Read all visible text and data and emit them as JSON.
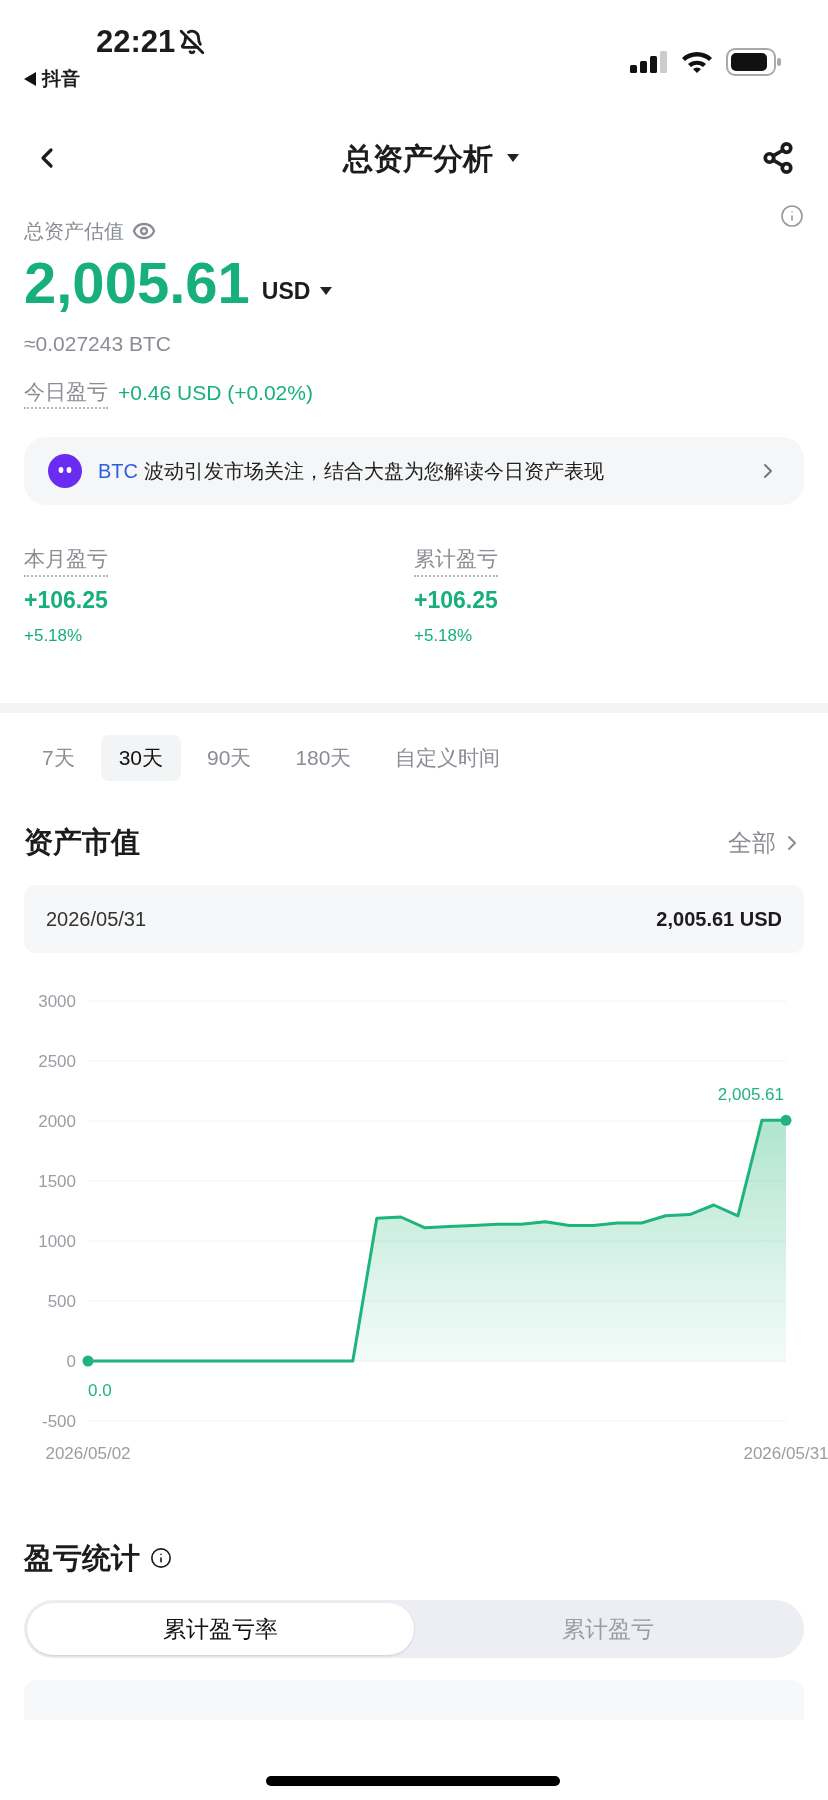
{
  "status_bar": {
    "time": "22:21",
    "back_app": "抖音"
  },
  "header": {
    "title": "总资产分析"
  },
  "summary": {
    "label": "总资产估值",
    "value": "2,005.61",
    "currency": "USD",
    "btc": "≈0.027243 BTC",
    "today_label": "今日盈亏",
    "today_value": "+0.46 USD (+0.02%)"
  },
  "banner": {
    "highlight": "BTC",
    "text": "波动引发市场关注，结合大盘为您解读今日资产表现"
  },
  "pnl": [
    {
      "label": "本月盈亏",
      "value": "+106.25",
      "percent": "+5.18%"
    },
    {
      "label": "累计盈亏",
      "value": "+106.25",
      "percent": "+5.18%"
    }
  ],
  "range_tabs": [
    {
      "label": "7天",
      "selected": false
    },
    {
      "label": "30天",
      "selected": true
    },
    {
      "label": "90天",
      "selected": false
    },
    {
      "label": "180天",
      "selected": false
    },
    {
      "label": "自定义时间",
      "selected": false
    }
  ],
  "asset_value": {
    "title": "资产市值",
    "link": "全部",
    "date": "2026/05/31",
    "amount": "2,005.61 USD",
    "chart_data": {
      "type": "area",
      "ylim": [
        -500,
        3000
      ],
      "yticks": [
        3000,
        2500,
        2000,
        1500,
        1000,
        500,
        0,
        -500
      ],
      "grid": true,
      "categories": [
        "2026/05/02",
        null,
        null,
        null,
        null,
        null,
        null,
        null,
        null,
        null,
        null,
        null,
        null,
        null,
        null,
        null,
        null,
        null,
        null,
        null,
        null,
        null,
        null,
        null,
        null,
        null,
        null,
        null,
        null,
        "2026/05/31"
      ],
      "series": [
        {
          "color": "#1fb47c",
          "values": [
            0,
            0,
            0,
            0,
            0,
            0,
            0,
            0,
            0,
            0,
            0,
            0,
            1190,
            1200,
            1110,
            1120,
            1130,
            1140,
            1140,
            1160,
            1130,
            1130,
            1150,
            1150,
            1210,
            1220,
            1300,
            1210,
            2005.61,
            2005.61
          ]
        }
      ],
      "annotations": [
        {
          "x": "2026/05/02",
          "y": 0,
          "text": "0.0"
        },
        {
          "x": "2026/05/31",
          "y": 2005.61,
          "text": "2,005.61"
        }
      ]
    }
  },
  "pnl_stats": {
    "title": "盈亏统计",
    "tabs": [
      {
        "label": "累计盈亏率",
        "selected": true
      },
      {
        "label": "累计盈亏",
        "selected": false
      }
    ]
  }
}
